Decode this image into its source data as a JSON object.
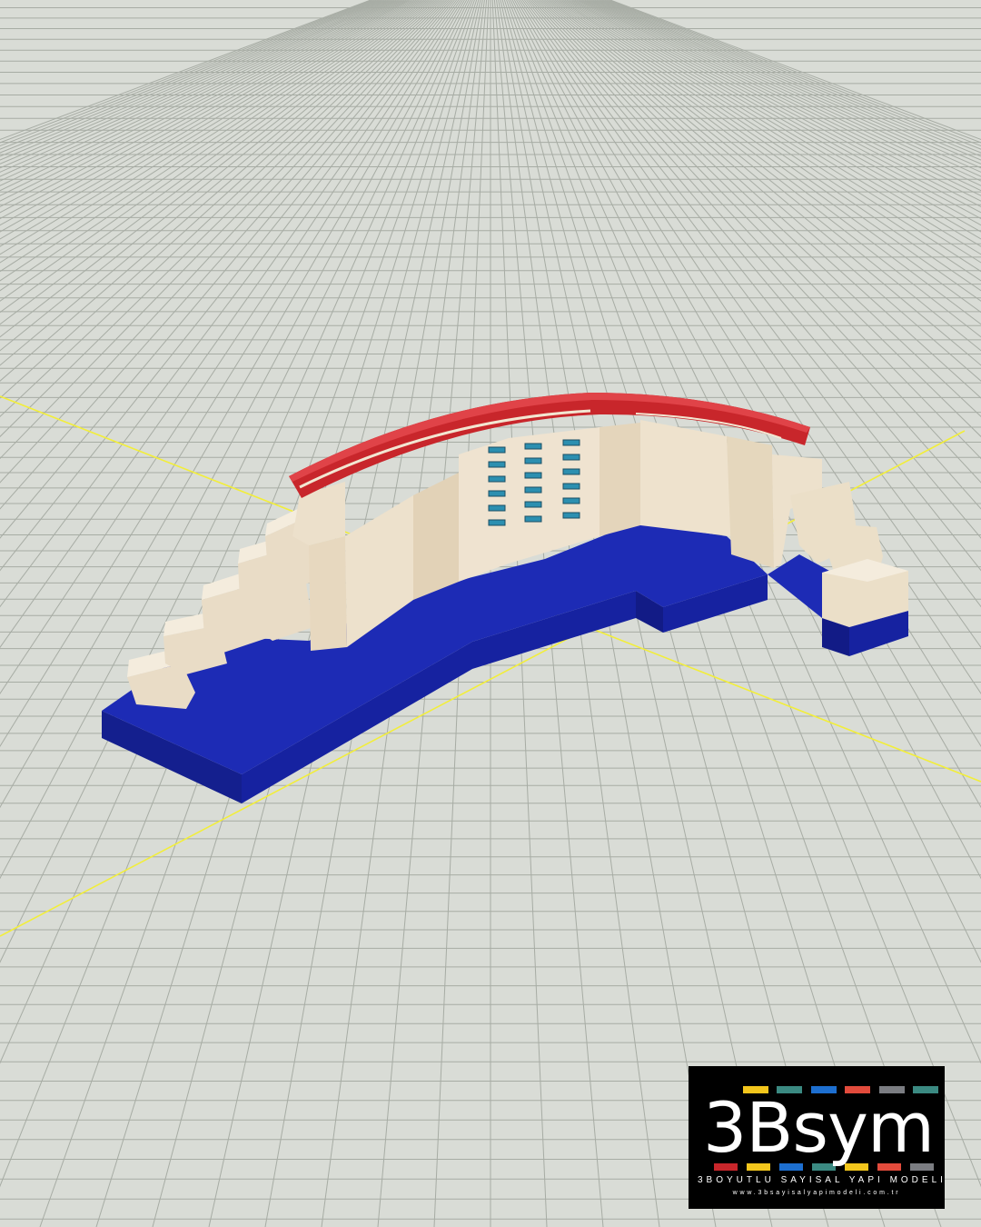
{
  "viewer": {
    "ground_color": "#d9dcd6",
    "grid_line_color": "#a7aca4",
    "axis_color": "#f2ee3a"
  },
  "model": {
    "roof_color": "#c8262b",
    "wall_color": "#efe3d0",
    "base_color": "#1d2bb5",
    "window_color": "#2c8fb0"
  },
  "logo": {
    "wordmark": "3Bsym",
    "tagline": "3BOYUTLU SAYISAL YAPI MODELI",
    "url": "www.3bsayisalyapimodeli.com.tr",
    "palette": [
      "#c8262b",
      "#f3c61c",
      "#1d6fd0",
      "#7b7d82",
      "#3b8a82",
      "#2a9ad6",
      "#e24b3c"
    ]
  }
}
